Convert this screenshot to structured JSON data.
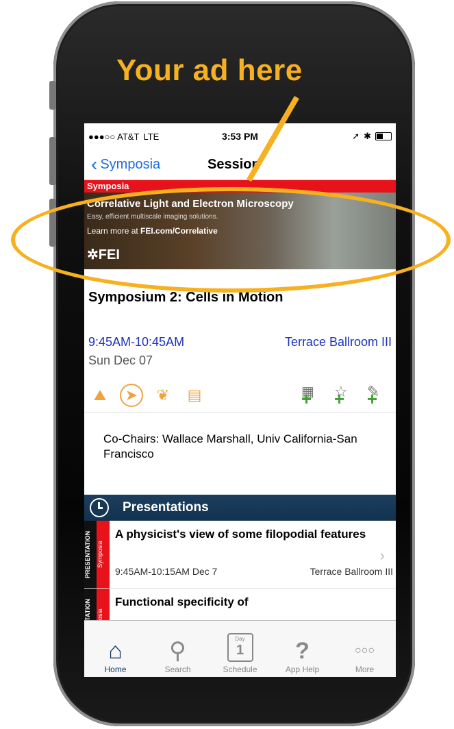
{
  "ad": {
    "text": "Your ad here"
  },
  "status": {
    "carrier": "●●●○○ AT&T",
    "network": "LTE",
    "time": "3:53 PM"
  },
  "nav": {
    "back_label": "Symposia",
    "title": "Session"
  },
  "category": "Symposia",
  "banner": {
    "line1": "Correlative Light and Electron Microscopy",
    "line2": "Easy, efficient multiscale imaging solutions.",
    "line3_prefix": "Learn more at ",
    "line3_link": "FEI.com/Correlative",
    "logo": "FEI"
  },
  "session": {
    "title": "Symposium 2: Cells in Motion",
    "time": "9:45AM-10:45AM",
    "room": "Terrace Ballroom III",
    "date": "Sun Dec 07",
    "cochairs": "Co-Chairs: Wallace Marshall, Univ California-San Francisco"
  },
  "presentations": {
    "header": "Presentations",
    "items": [
      {
        "type": "PRESENTATION",
        "category": "Symposia",
        "title": "A physicist's view of some filopodial features",
        "time": "9:45AM-10:15AM  Dec 7",
        "room": "Terrace Ballroom III"
      },
      {
        "type": "PRESENTATION",
        "category": "Symposia",
        "title": "Functional specificity of",
        "time": "",
        "room": ""
      }
    ]
  },
  "tabs": [
    {
      "label": "Home",
      "icon": "home-icon"
    },
    {
      "label": "Search",
      "icon": "search-icon"
    },
    {
      "label": "Schedule",
      "icon": "calendar-icon",
      "cal_day": "Day",
      "cal_num": "1"
    },
    {
      "label": "App Help",
      "icon": "help-icon"
    },
    {
      "label": "More",
      "icon": "more-icon"
    }
  ],
  "colors": {
    "accent": "#f7b120",
    "link": "#1a6ddd",
    "red": "#e8121b",
    "navy": "#143b6b"
  }
}
